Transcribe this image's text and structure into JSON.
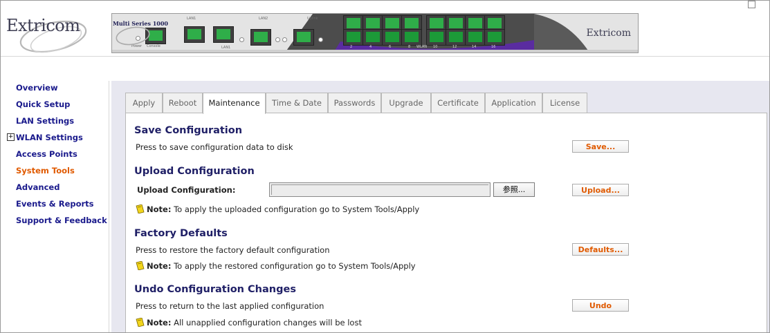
{
  "header": {
    "logo_text": "Extricom",
    "device_title": "Multi Series 1000",
    "device_logo_text": "Extricom",
    "port_labels": {
      "power": "Power",
      "console": "Console",
      "lan1_group": "LAN1",
      "lan1_a": "LAN1",
      "lan2": "LAN2",
      "uplink": "Uplink"
    },
    "port_numbers": [
      "2",
      "4",
      "6",
      "8",
      "WLAN",
      "10",
      "12",
      "14",
      "16"
    ]
  },
  "sidebar": {
    "items": [
      {
        "label": "Overview",
        "active": false,
        "expandable": false
      },
      {
        "label": "Quick Setup",
        "active": false,
        "expandable": false
      },
      {
        "label": "LAN Settings",
        "active": false,
        "expandable": false
      },
      {
        "label": "WLAN Settings",
        "active": false,
        "expandable": true,
        "expand_glyph": "+"
      },
      {
        "label": "Access Points",
        "active": false,
        "expandable": false
      },
      {
        "label": "System Tools",
        "active": true,
        "expandable": false
      },
      {
        "label": "Advanced",
        "active": false,
        "expandable": false
      },
      {
        "label": "Events & Reports",
        "active": false,
        "expandable": false
      },
      {
        "label": "Support & Feedback",
        "active": false,
        "expandable": false
      }
    ]
  },
  "tabs": [
    {
      "label": "Apply",
      "active": false
    },
    {
      "label": "Reboot",
      "active": false
    },
    {
      "label": "Maintenance",
      "active": true
    },
    {
      "label": "Time & Date",
      "active": false
    },
    {
      "label": "Passwords",
      "active": false
    },
    {
      "label": "Upgrade",
      "active": false
    },
    {
      "label": "Certificate",
      "active": false
    },
    {
      "label": "Application",
      "active": false
    },
    {
      "label": "License",
      "active": false
    }
  ],
  "sections": {
    "save": {
      "title": "Save Configuration",
      "description": "Press to save configuration data to disk",
      "button": "Save..."
    },
    "upload": {
      "title": "Upload Configuration",
      "field_label": "Upload Configuration:",
      "file_value": "",
      "browse_button": "参照...",
      "button": "Upload...",
      "note_label": "Note:",
      "note_text": " To apply the uploaded configuration go to System Tools/Apply"
    },
    "factory": {
      "title": "Factory Defaults",
      "description": "Press to restore the factory default configuration",
      "button": "Defaults...",
      "note_label": "Note:",
      "note_text": " To apply the restored configuration go to System Tools/Apply"
    },
    "undo": {
      "title": "Undo Configuration Changes",
      "description": "Press to return to the last applied configuration",
      "button": "Undo",
      "note_label": "Note:",
      "note_text": " All unapplied configuration changes will be lost"
    }
  },
  "colors": {
    "nav_link": "#1a1a8c",
    "nav_active": "#e05a00",
    "section_title": "#1f1f66",
    "button_text": "#e05a00",
    "content_background": "#e7e7f0",
    "port_green": "#2fae49",
    "device_accent": "#5a2ca0"
  },
  "icons": {
    "note": "note-pencil-icon",
    "expand": "plus-box-icon"
  }
}
